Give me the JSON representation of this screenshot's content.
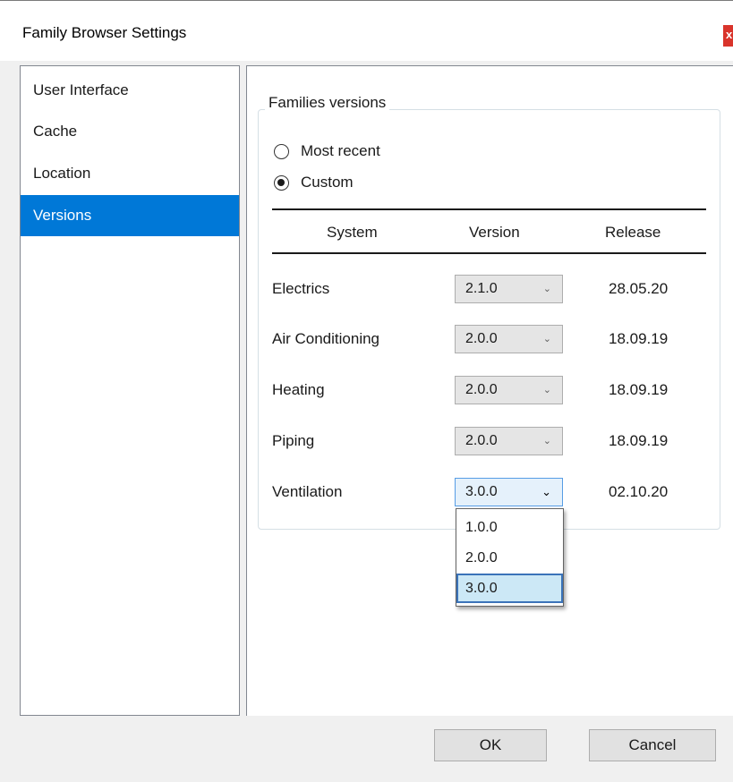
{
  "window": {
    "title": "Family Browser Settings",
    "close_label": "x"
  },
  "sidebar": {
    "items": [
      {
        "label": "User Interface",
        "selected": false
      },
      {
        "label": "Cache",
        "selected": false
      },
      {
        "label": "Location",
        "selected": false
      },
      {
        "label": "Versions",
        "selected": true
      }
    ]
  },
  "families_versions": {
    "legend": "Families versions",
    "radio_most_recent": "Most recent",
    "radio_custom": "Custom",
    "selected_option": "Custom",
    "columns": {
      "system": "System",
      "version": "Version",
      "release": "Release"
    },
    "rows": [
      {
        "system": "Electrics",
        "version": "2.1.0",
        "release": "28.05.20"
      },
      {
        "system": "Air Conditioning",
        "version": "2.0.0",
        "release": "18.09.19"
      },
      {
        "system": "Heating",
        "version": "2.0.0",
        "release": "18.09.19"
      },
      {
        "system": "Piping",
        "version": "2.0.0",
        "release": "18.09.19"
      },
      {
        "system": "Ventilation",
        "version": "3.0.0",
        "release": "02.10.20"
      }
    ],
    "open_dropdown": {
      "options": [
        "1.0.0",
        "2.0.0",
        "3.0.0"
      ],
      "selected": "3.0.0"
    }
  },
  "footer": {
    "ok_label": "OK",
    "cancel_label": "Cancel"
  },
  "icons": {
    "close": "close-icon",
    "chevron": "chevron-down-icon"
  },
  "colors": {
    "accent": "#0078d7",
    "close_button": "#d9342b",
    "dropdown_highlight": "#cce8f6"
  }
}
